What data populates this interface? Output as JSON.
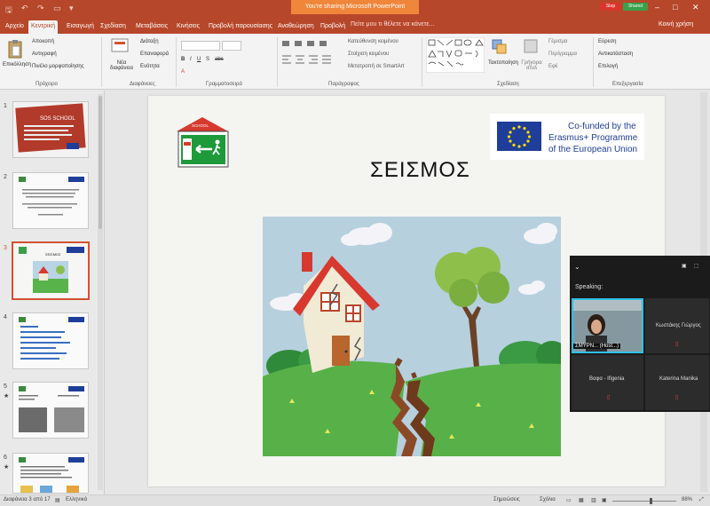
{
  "window": {
    "share_banner": "You're sharing Microsoft PowerPoint",
    "stop_label": "Stop",
    "shared_label": "Shared",
    "minimize": "–",
    "maximize": "□",
    "close": "✕"
  },
  "tabs": [
    {
      "label": "Αρχείο"
    },
    {
      "label": "Κεντρική"
    },
    {
      "label": "Εισαγωγή"
    },
    {
      "label": "Σχεδίαση"
    },
    {
      "label": "Μεταβάσεις"
    },
    {
      "label": "Κινήσεις"
    },
    {
      "label": "Προβολή παρουσίασης"
    },
    {
      "label": "Αναθεώρηση"
    },
    {
      "label": "Προβολή"
    }
  ],
  "tellme": "Πείτε μου τι θέλετε να κάνετε...",
  "share_user": "Κοινή χρήση",
  "ribbon": {
    "clipboard": {
      "paste": "Επικόλληση",
      "cut": "Αποκοπή",
      "copy": "Αντιγραφή",
      "format_painter": "Πινέλο μορφοποίησης",
      "label": "Πρόχειρο"
    },
    "slides": {
      "new_slide": "Νέα διαφάνεια",
      "layout": "Διάταξη",
      "reset": "Επαναφορά",
      "section": "Ενότητα",
      "label": "Διαφάνειες"
    },
    "font": {
      "label": "Γραμματοσειρά"
    },
    "paragraph": {
      "text_direction": "Κατεύθυνση κειμένου",
      "align_text": "Στοίχιση κειμένου",
      "smartart": "Μετατροπή σε SmartArt",
      "label": "Παράγραφος"
    },
    "drawing": {
      "arrange": "Τακτοποίηση",
      "quick_styles": "Γρήγορα στυλ",
      "shape_fill": "Γέμισμα",
      "shape_outline": "Περίγραμμα",
      "shape_effects": "Εφέ",
      "label": "Σχεδίαση"
    },
    "editing": {
      "find": "Εύρεση",
      "replace": "Αντικατάσταση",
      "select": "Επιλογή",
      "label": "Επεξεργασία"
    }
  },
  "thumbnails": [
    {
      "num": "1",
      "title": "SOS SCHOOL"
    },
    {
      "num": "2"
    },
    {
      "num": "3",
      "title": "ΣΕΙΣΜΟΣ"
    },
    {
      "num": "4"
    },
    {
      "num": "5"
    },
    {
      "num": "6"
    }
  ],
  "slide": {
    "school_sign": "SCHOOL",
    "title": "ΣΕΙΣΜΟΣ",
    "eu_line1": "Co-funded by the",
    "eu_line2": "Erasmus+ Programme",
    "eu_line3": "of the European Union"
  },
  "meeting": {
    "speaking": "Speaking:",
    "host": "ΣΜΥΡΝ... (Host...)",
    "p2": "Κωστάκης Γιώργος",
    "p3": "Βαφα - Ifigenia",
    "p4": "Katerina Manika"
  },
  "status": {
    "slide_info": "Διαφάνεια 3 από 17",
    "language": "Ελληνικά",
    "notes": "Σημειώσεις",
    "comments": "Σχόλια",
    "zoom": "88%"
  },
  "colors": {
    "accent": "#b7472a",
    "selected_thumb": "#d35230",
    "share_banner": "#f0863a"
  }
}
